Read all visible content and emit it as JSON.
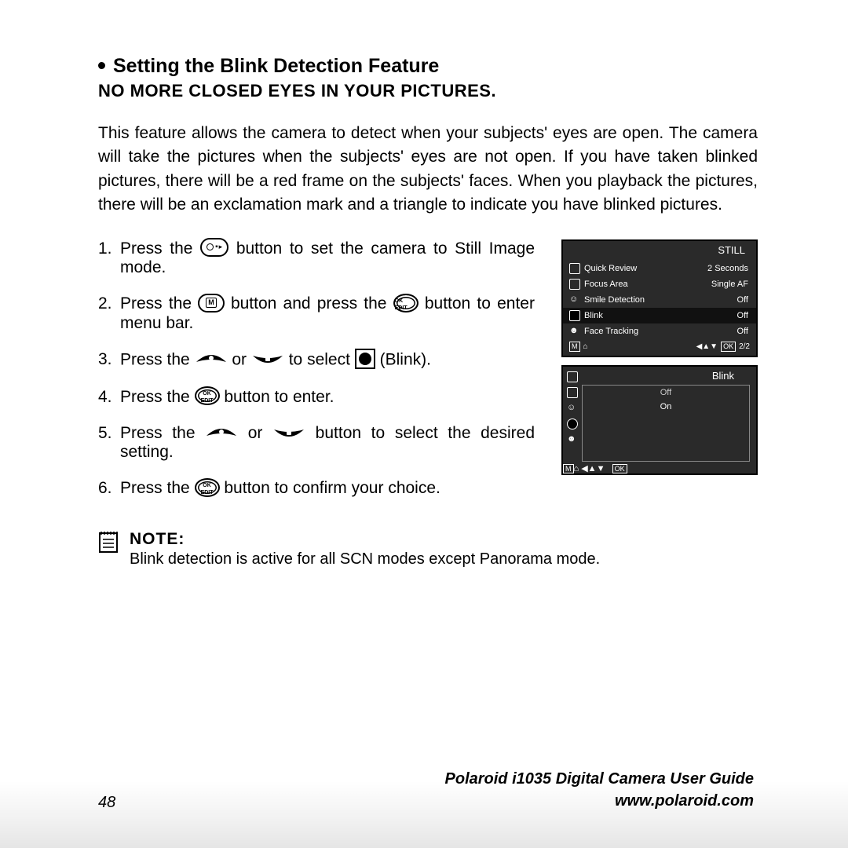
{
  "heading": "Setting the Blink Detection Feature",
  "subheading": "NO MORE CLOSED EYES IN YOUR PICTURES.",
  "intro": "This feature allows the camera to detect when your subjects' eyes are open. The camera will take the pictures when the subjects' eyes are not open. If you have taken blinked pictures, there will be a red frame on the subjects' faces. When you playback the pictures, there will be an exclamation mark and a triangle to indicate you have blinked pictures.",
  "steps": {
    "s1a": "Press the ",
    "s1b": " button to set the camera to Still Image mode.",
    "s2a": "Press the ",
    "s2b": " button and press the ",
    "s2c": " button to enter menu bar.",
    "s3a": "Press the ",
    "s3b": " or ",
    "s3c": " to select ",
    "s3d": " (Blink).",
    "s4a": "Press the ",
    "s4b": " button to enter.",
    "s5a": "Press the ",
    "s5b": " or ",
    "s5c": " button to select the desired setting.",
    "s6a": "Press the ",
    "s6b": " button to confirm your choice."
  },
  "screen1": {
    "title": "STILL",
    "rows": [
      {
        "label": "Quick Review",
        "value": "2 Seconds"
      },
      {
        "label": "Focus Area",
        "value": "Single AF"
      },
      {
        "label": "Smile Detection",
        "value": "Off"
      },
      {
        "label": "Blink",
        "value": "Off",
        "hl": true
      },
      {
        "label": "Face Tracking",
        "value": "Off"
      }
    ],
    "footer_right": "2/2",
    "footer_ok": "OK",
    "footer_arrows": "◀▲▼"
  },
  "screen2": {
    "title": "Blink",
    "options": [
      "Off",
      "On"
    ],
    "footer_ok": "OK",
    "footer_arrows": "◀▲▼"
  },
  "note": {
    "label": "NOTE:",
    "text": "Blink detection is active for all SCN modes except Panorama mode."
  },
  "footer": {
    "page": "48",
    "guide_line1": "Polaroid i1035 Digital Camera User Guide",
    "guide_line2": "www.polaroid.com"
  },
  "ok_edit": "OK\nEDIT"
}
